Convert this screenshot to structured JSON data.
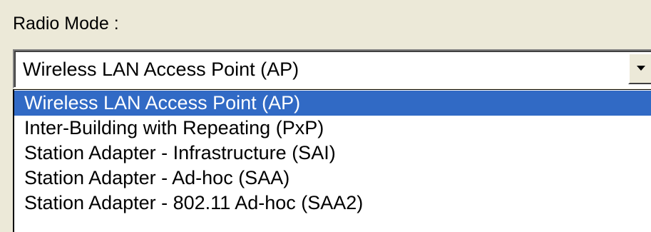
{
  "radio_mode": {
    "label": "Radio Mode :",
    "selected_value": "Wireless LAN Access Point (AP)",
    "dropdown_icon": "chevron-down-icon",
    "options": [
      {
        "label": "Wireless LAN Access Point (AP)",
        "selected": true
      },
      {
        "label": "Inter-Building with Repeating (PxP)",
        "selected": false
      },
      {
        "label": "Station Adapter - Infrastructure (SAI)",
        "selected": false
      },
      {
        "label": "Station Adapter - Ad-hoc (SAA)",
        "selected": false
      },
      {
        "label": "Station Adapter - 802.11 Ad-hoc (SAA2)",
        "selected": false
      }
    ]
  },
  "colors": {
    "background": "#ece9d8",
    "highlight": "#316ac5",
    "highlight_text": "#ffffff"
  }
}
